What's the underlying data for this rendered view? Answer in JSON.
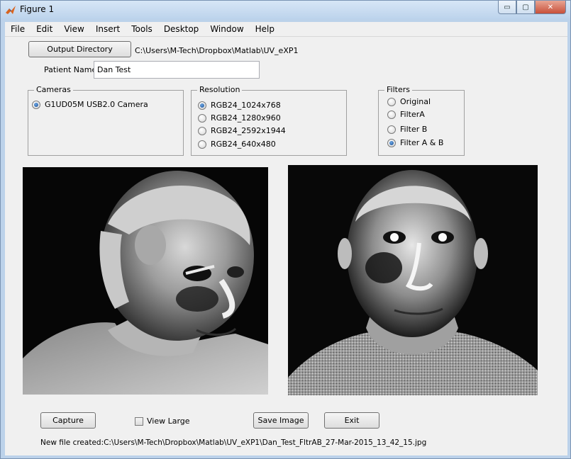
{
  "window": {
    "title": "Figure 1",
    "minimize_glyph": "▭",
    "maximize_glyph": "▢",
    "close_glyph": "✕"
  },
  "menubar": {
    "items": [
      "File",
      "Edit",
      "View",
      "Insert",
      "Tools",
      "Desktop",
      "Window",
      "Help"
    ]
  },
  "output": {
    "button_label": "Output Directory",
    "path": "C:\\Users\\M-Tech\\Dropbox\\Matlab\\UV_eXP1"
  },
  "patient": {
    "label": "Patient Name",
    "value": "Dan Test"
  },
  "cameras": {
    "title": "Cameras",
    "options": [
      {
        "label": "G1UD05M USB2.0 Camera",
        "selected": true
      }
    ]
  },
  "resolution": {
    "title": "Resolution",
    "options": [
      {
        "label": "RGB24_1024x768",
        "selected": true
      },
      {
        "label": "RGB24_1280x960",
        "selected": false
      },
      {
        "label": "RGB24_2592x1944",
        "selected": false
      },
      {
        "label": "RGB24_640x480",
        "selected": false
      }
    ]
  },
  "filters": {
    "title": "Filters",
    "options": [
      {
        "label": "Original",
        "selected": false
      },
      {
        "label": "FilterA",
        "selected": false
      },
      {
        "label": "Filter B",
        "selected": false
      },
      {
        "label": "Filter A & B",
        "selected": true
      }
    ]
  },
  "controls": {
    "capture_label": "Capture",
    "view_large_label": "View Large",
    "view_large_checked": false,
    "save_label": "Save Image",
    "exit_label": "Exit"
  },
  "status": {
    "text": "New file created:C:\\Users\\M-Tech\\Dropbox\\Matlab\\UV_eXP1\\Dan_Test_FltrAB_27-Mar-2015_13_42_15.jpg"
  },
  "images": {
    "left": "grayscale-uv-face-photo-profile",
    "right": "grayscale-uv-face-photo-frontal"
  }
}
